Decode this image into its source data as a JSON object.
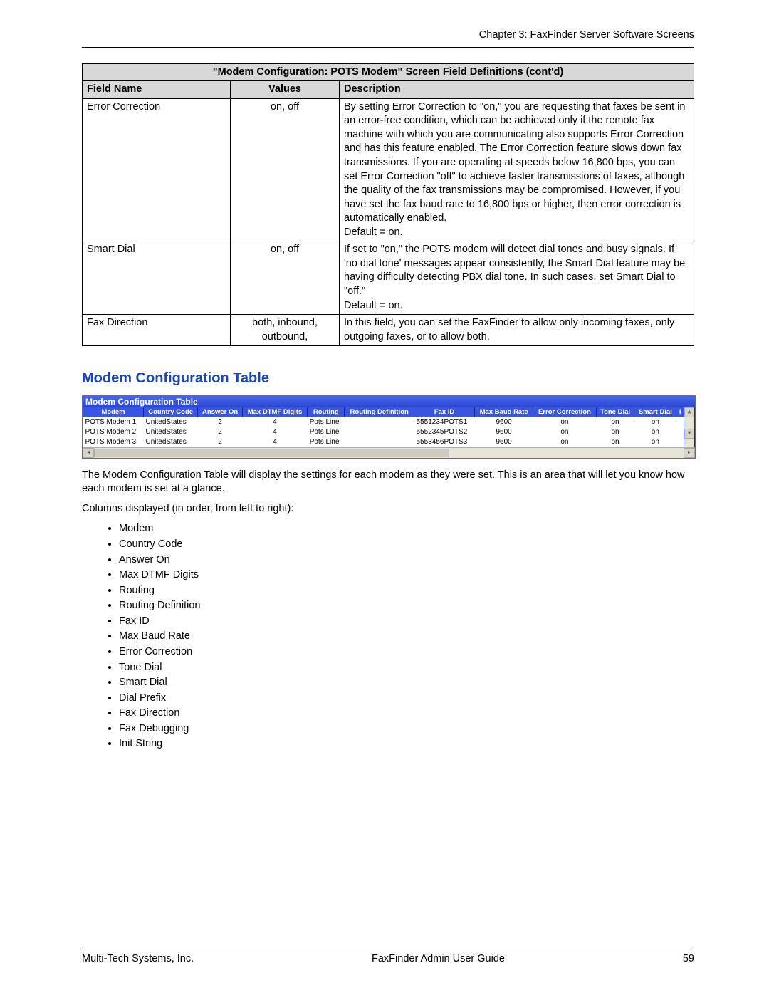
{
  "header": {
    "chapter": "Chapter 3: FaxFinder Server Software Screens"
  },
  "defs_table": {
    "title": "\"Modem Configuration: POTS Modem\" Screen Field Definitions (cont'd)",
    "headers": {
      "field": "Field Name",
      "values": "Values",
      "desc": "Description"
    },
    "rows": [
      {
        "field": "Error Correction",
        "values": "on, off",
        "desc": "By setting Error Correction to \"on,\" you are requesting that faxes be sent in an error-free condition, which can be achieved only if the remote fax machine with which you are communicating also supports Error Correction and has this feature enabled. The Error Correction feature slows down fax transmissions. If you are operating at speeds below 16,800 bps, you can set Error Correction \"off\" to achieve faster transmissions of faxes, although the quality of the fax transmissions may be compromised. However, if you have set the fax baud rate to 16,800 bps or higher, then error correction is automatically enabled.\nDefault = on."
      },
      {
        "field": "Smart Dial",
        "values": "on, off",
        "desc": "If set to \"on,\" the POTS modem will detect dial tones and  busy signals.  If 'no dial tone' messages appear consistently, the Smart Dial feature may be having difficulty detecting PBX dial tone.  In such cases, set Smart Dial to \"off.\"\nDefault = on."
      },
      {
        "field": "Fax Direction",
        "values": "both, inbound, outbound,",
        "desc": "In this field, you can set the FaxFinder to allow only incoming faxes, only outgoing faxes, or to allow both."
      }
    ]
  },
  "section_title": "Modem Configuration Table",
  "mct": {
    "bar": "Modem Configuration Table",
    "headers": [
      "Modem",
      "Country Code",
      "Answer On",
      "Max DTMF Digits",
      "Routing",
      "Routing Definition",
      "Fax ID",
      "Max Baud Rate",
      "Error Correction",
      "Tone Dial",
      "Smart Dial",
      "I"
    ],
    "rows": [
      {
        "c": [
          "POTS Modem 1",
          "UnitedStates",
          "2",
          "4",
          "Pots Line",
          "",
          "5551234POTS1",
          "9600",
          "on",
          "on",
          "on"
        ]
      },
      {
        "c": [
          "POTS Modem 2",
          "UnitedStates",
          "2",
          "4",
          "Pots Line",
          "",
          "5552345POTS2",
          "9600",
          "on",
          "on",
          "on"
        ]
      },
      {
        "c": [
          "POTS Modem 3",
          "UnitedStates",
          "2",
          "4",
          "Pots Line",
          "",
          "5553456POTS3",
          "9600",
          "on",
          "on",
          "on"
        ]
      }
    ]
  },
  "para1": "The Modem Configuration Table will display the settings for each modem as they were set. This is an area that will let you know how each modem is set at a glance.",
  "para2": "Columns displayed (in order, from left to right):",
  "columns_list": [
    "Modem",
    "Country Code",
    "Answer On",
    "Max DTMF Digits",
    "Routing",
    "Routing Definition",
    "Fax ID",
    "Max Baud Rate",
    "Error Correction",
    "Tone Dial",
    "Smart Dial",
    "Dial Prefix",
    "Fax Direction",
    "Fax Debugging",
    "Init String"
  ],
  "footer": {
    "left": "Multi-Tech Systems, Inc.",
    "center": "FaxFinder Admin User Guide",
    "right": "59"
  }
}
